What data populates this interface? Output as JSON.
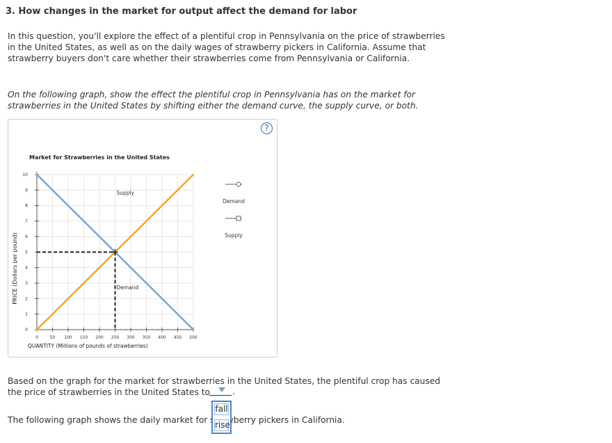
{
  "question": {
    "title": "3. How changes in the market for output affect the demand for labor",
    "intro": "In this question, you'll explore the effect of a plentiful crop in Pennsylvania on the price of strawberries in the United States, as well as on the daily wages of strawberry pickers in California. Assume that strawberry buyers don't care whether their strawberries come from Pennsylvania or California.",
    "instruction": "On the following graph, show the effect the plentiful crop in Pennsylvania has on the market for strawberries in the United States by shifting either the demand curve, the supply curve, or both."
  },
  "graph": {
    "help_icon": "?",
    "help_icon_name": "question-mark-icon",
    "legend": [
      {
        "label": "Demand",
        "marker": "circle"
      },
      {
        "label": "Supply",
        "marker": "square"
      }
    ]
  },
  "chart_data": {
    "type": "line",
    "title": "Market for Strawberries in the United States",
    "xlabel": "QUANTITY (Millions of pounds of strawberries)",
    "ylabel": "PRICE (Dollars per pound)",
    "xlim": [
      0,
      500
    ],
    "ylim": [
      0,
      10
    ],
    "x_ticks": [
      0,
      50,
      100,
      150,
      200,
      250,
      300,
      350,
      400,
      450,
      500
    ],
    "y_ticks": [
      0,
      1,
      2,
      3,
      4,
      5,
      6,
      7,
      8,
      9,
      10
    ],
    "grid": true,
    "series": [
      {
        "name": "Demand",
        "color": "#7aa6cf",
        "points": [
          [
            0,
            10
          ],
          [
            500,
            0
          ]
        ],
        "label_at": [
          250,
          2.6
        ]
      },
      {
        "name": "Supply",
        "color": "#f5a623",
        "points": [
          [
            0,
            0
          ],
          [
            500,
            10
          ]
        ],
        "label_at": [
          250,
          8.7
        ]
      }
    ],
    "equilibrium": {
      "x": 250,
      "y": 5
    }
  },
  "followup": {
    "text_before": "Based on the graph for the market for strawberries in the United States, the plentiful crop has caused the price of strawberries in the United States to",
    "text_after": ".",
    "dropdown_options": [
      "fall",
      "rise"
    ],
    "next_text": "The following graph shows the daily market for strawberry pickers in California."
  }
}
